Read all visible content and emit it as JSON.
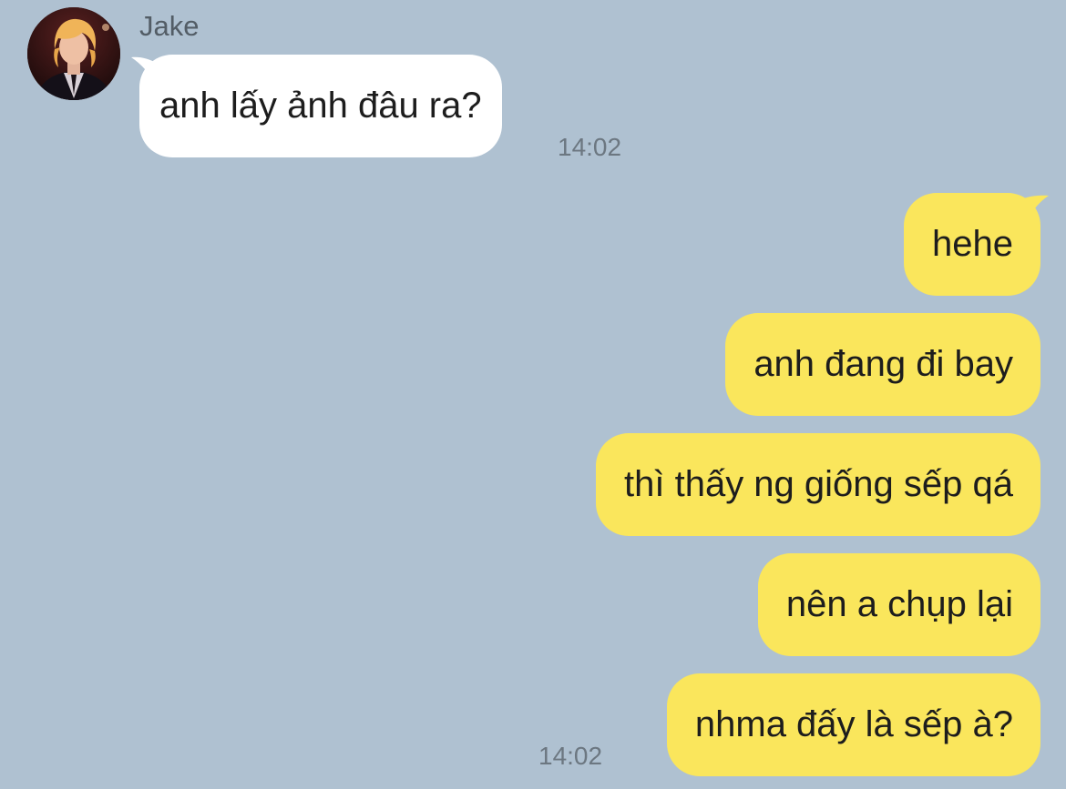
{
  "contact": {
    "name": "Jake"
  },
  "messages": {
    "incoming": [
      {
        "text": "anh lấy ảnh đâu ra?",
        "time": "14:02"
      }
    ],
    "outgoing": [
      {
        "text": "hehe"
      },
      {
        "text": "anh đang đi bay"
      },
      {
        "text": "thì thấy ng giống sếp qá"
      },
      {
        "text": "nên a chụp lại"
      },
      {
        "text": "nhma đấy là sếp à?",
        "time": "14:02"
      }
    ]
  },
  "colors": {
    "background": "#afc1d1",
    "incoming_bubble": "#ffffff",
    "outgoing_bubble": "#fae65c",
    "timestamp": "#6c7781",
    "sender_name": "#535d66"
  }
}
